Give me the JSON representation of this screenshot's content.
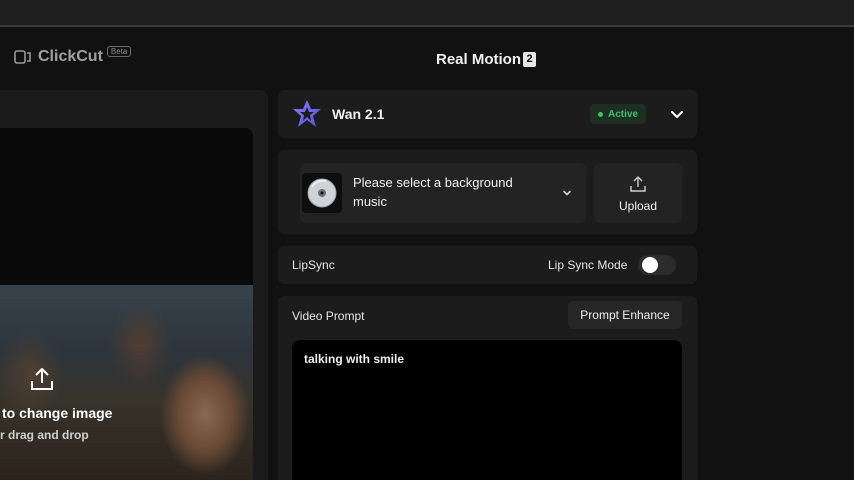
{
  "app": {
    "logo_text": "ClickCut",
    "beta_label": "Beta",
    "title": "Real Motion",
    "title_badge": "2"
  },
  "image_panel": {
    "change_text": "to change image",
    "drag_text": "r drag and drop",
    "upload_icon": "upload-icon"
  },
  "model": {
    "name": "Wan 2.1",
    "status": "Active",
    "status_color": "#3fbf6a",
    "logo_icon": "wan-logo-icon"
  },
  "music": {
    "placeholder": "Please select a background music",
    "thumb_icon": "disc-icon",
    "upload_label": "Upload"
  },
  "lipsync": {
    "label": "LipSync",
    "mode_label": "Lip Sync Mode",
    "enabled": false
  },
  "prompt": {
    "label": "Video Prompt",
    "enhance_label": "Prompt Enhance",
    "value": "talking with smile"
  }
}
